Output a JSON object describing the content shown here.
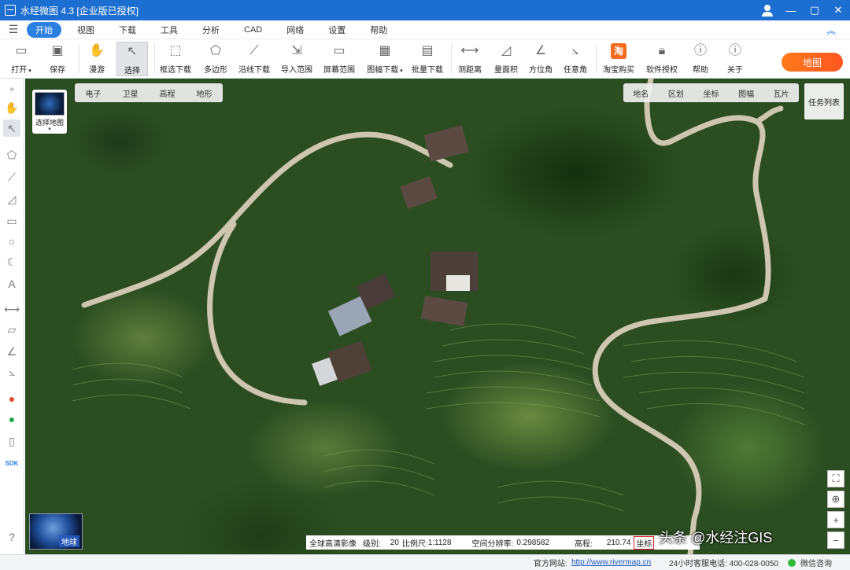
{
  "window": {
    "title": "水经微图 4.3 [企业版已授权]",
    "controls": [
      "—",
      "▢",
      "✕"
    ]
  },
  "menubar": {
    "items": [
      "开始",
      "视图",
      "下载",
      "工具",
      "分析",
      "CAD",
      "网络",
      "设置",
      "帮助"
    ],
    "active": "开始"
  },
  "toolbar": {
    "open": "打开",
    "save": "保存",
    "pan": "漫游",
    "select": "选择",
    "box_download": "框选下载",
    "polygon": "多边形",
    "line_download": "沿线下载",
    "import_range": "导入范围",
    "screen_range": "屏幕范围",
    "sheet_download": "图幅下载",
    "batch_download": "批量下载",
    "measure_distance": "测距离",
    "measure_area": "量面积",
    "azimuth": "方位角",
    "any_angle": "任意角",
    "taobao_buy": "淘宝购买",
    "software_license": "软件授权",
    "help": "帮助",
    "about": "关于",
    "earth_button": "地图"
  },
  "map": {
    "switcher_label": "选择地图",
    "map_types": [
      "电子",
      "卫星",
      "高程",
      "地形"
    ],
    "overlay_types": [
      "地名",
      "区划",
      "坐标",
      "图幅",
      "瓦片"
    ],
    "task_list": "任务列表",
    "globe_label": "地球"
  },
  "status": {
    "source": "全球高清影像",
    "level_label": "级别:",
    "level": "20",
    "scale_label": "比例尺:",
    "scale": "1:1128",
    "resolution_label": "空间分辨率:",
    "resolution": "0.298582",
    "elevation_label": "高程:",
    "elevation": "210.74",
    "coord_label": "坐标"
  },
  "watermark": "头条 @水经注GIS",
  "footer": {
    "site_label": "官方网站:",
    "site_url": "http://www.rivermap.cn",
    "hotline": "24小时客服电话: 400-028-0050",
    "wechat": "微信咨询"
  },
  "colors": {
    "title_bar": "#1c6fd0",
    "active_menu": "#2b7fe0",
    "earth_button": "#ff6a1a",
    "taobao_icon": "#f26a1b",
    "road": "#cfc6b0"
  }
}
